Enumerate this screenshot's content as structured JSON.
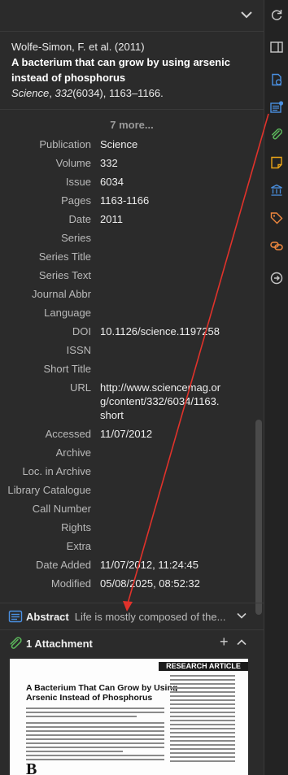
{
  "header": {
    "citation": "Wolfe-Simon, F. et al. (2011)",
    "title": "A bacterium that can grow by using arsenic instead of phosphorus",
    "source_journal": "Science",
    "source_volume": "332",
    "source_rest": "(6034), 1163–1166."
  },
  "more_label": "7 more...",
  "fields": [
    {
      "label": "Publication",
      "value": "Science"
    },
    {
      "label": "Volume",
      "value": "332"
    },
    {
      "label": "Issue",
      "value": "6034"
    },
    {
      "label": "Pages",
      "value": "1163-1166"
    },
    {
      "label": "Date",
      "value": "2011"
    },
    {
      "label": "Series",
      "value": ""
    },
    {
      "label": "Series Title",
      "value": ""
    },
    {
      "label": "Series Text",
      "value": ""
    },
    {
      "label": "Journal Abbr",
      "value": ""
    },
    {
      "label": "Language",
      "value": ""
    },
    {
      "label": "DOI",
      "value": "10.1126/science.1197258"
    },
    {
      "label": "ISSN",
      "value": ""
    },
    {
      "label": "Short Title",
      "value": ""
    },
    {
      "label": "URL",
      "value": "http://www.sciencemag.org/content/332/6034/1163.short"
    },
    {
      "label": "Accessed",
      "value": "11/07/2012"
    },
    {
      "label": "Archive",
      "value": ""
    },
    {
      "label": "Loc. in Archive",
      "value": ""
    },
    {
      "label": "Library Catalogue",
      "value": ""
    },
    {
      "label": "Call Number",
      "value": ""
    },
    {
      "label": "Rights",
      "value": ""
    },
    {
      "label": "Extra",
      "value": ""
    },
    {
      "label": "Date Added",
      "value": "11/07/2012, 11:24:45"
    },
    {
      "label": "Modified",
      "value": "05/08/2025, 08:52:32"
    }
  ],
  "abstract": {
    "title": "Abstract",
    "preview": "Life is mostly composed of the..."
  },
  "attachments": {
    "title": "1 Attachment"
  },
  "attachment_preview": {
    "banner": "RESEARCH ARTICLE",
    "title": "A Bacterium That Can Grow by Using Arsenic Instead of Phosphorus",
    "drop_cap": "B"
  },
  "icons": {
    "collapse": "chevron-down-icon",
    "rail": [
      "refresh-icon",
      "split-pane-icon",
      "info-doc-icon",
      "abstract-icon",
      "attachment-icon",
      "notes-icon",
      "libraries-icon",
      "tags-icon",
      "related-icon",
      "locate-icon"
    ]
  },
  "colors": {
    "accent": "#4a90e2",
    "annotation_arrow": "#e0322b"
  }
}
